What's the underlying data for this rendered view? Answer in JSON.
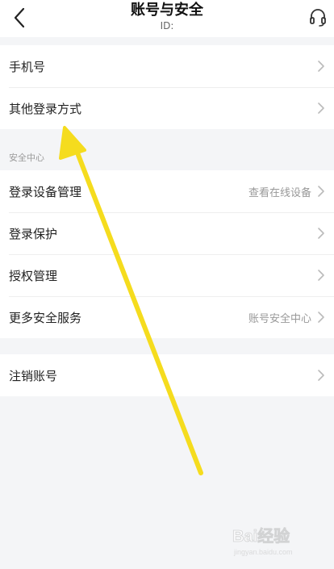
{
  "header": {
    "title": "账号与安全",
    "subtitle": "ID:"
  },
  "groups": {
    "account": {
      "items": [
        {
          "label": "手机号"
        },
        {
          "label": "其他登录方式"
        }
      ]
    },
    "security": {
      "section_title": "安全中心",
      "items": [
        {
          "label": "登录设备管理",
          "value": "查看在线设备"
        },
        {
          "label": "登录保护"
        },
        {
          "label": "授权管理"
        },
        {
          "label": "更多安全服务",
          "value": "账号安全中心"
        }
      ]
    },
    "danger": {
      "items": [
        {
          "label": "注销账号"
        }
      ]
    }
  },
  "watermark": {
    "text": "Bai经验",
    "url": "jingyan.baidu.com"
  },
  "colors": {
    "annotation_arrow": "#f5dc1e",
    "chevron": "#bbbbbb",
    "background": "#f4f5f7"
  }
}
